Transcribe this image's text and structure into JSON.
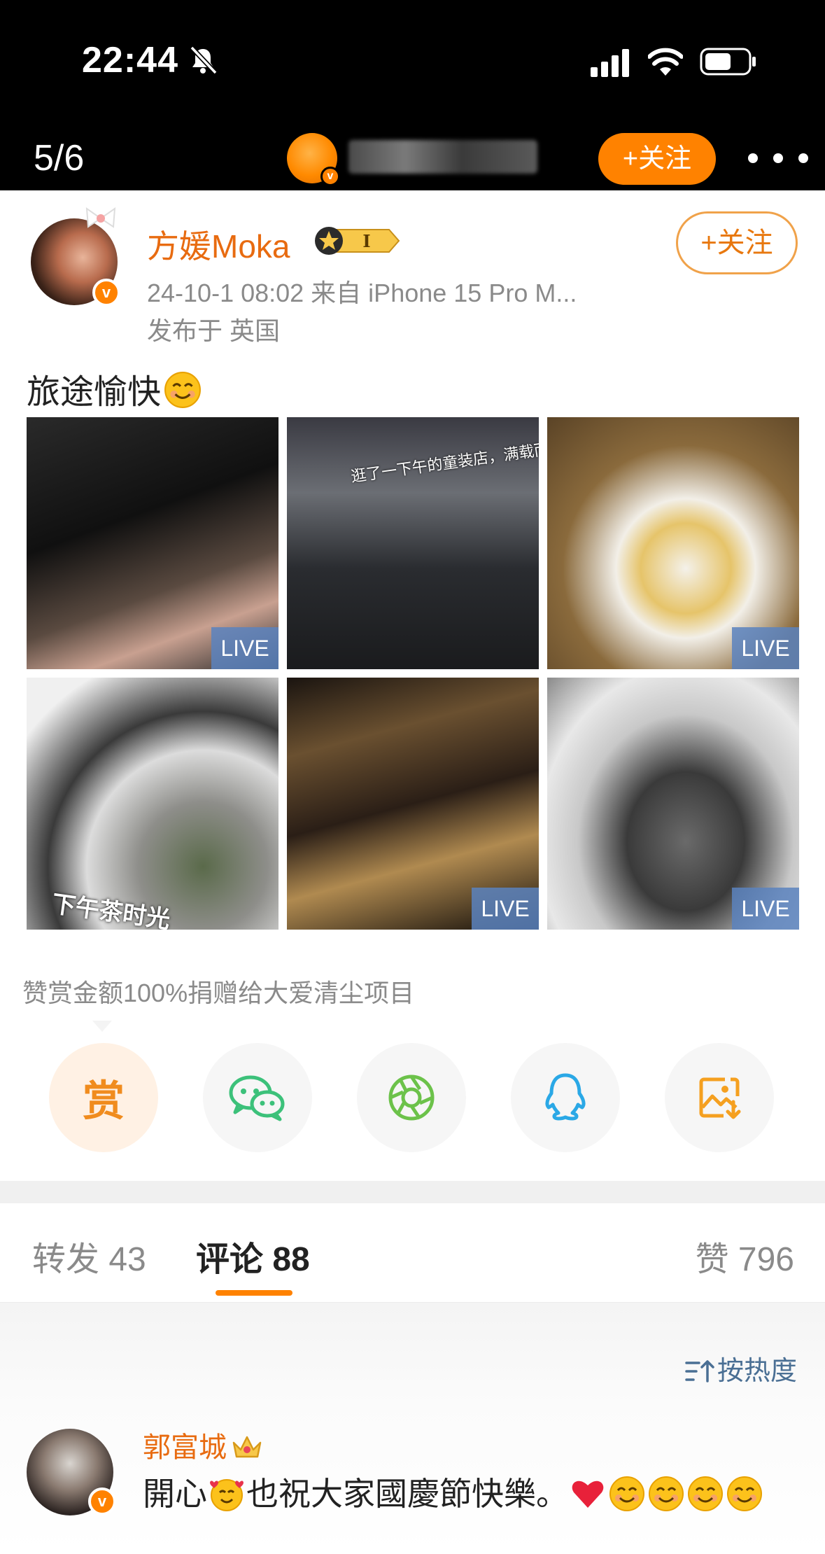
{
  "status_bar": {
    "time": "22:44"
  },
  "header": {
    "page_indicator": "5/6",
    "follow_label": "+关注"
  },
  "post": {
    "author": "方媛Moka",
    "vip_level": "I",
    "meta_line1": "24-10-1 08:02   来自 iPhone 15 Pro M...",
    "meta_line2": "发布于 英国",
    "follow_label": "+关注",
    "text": "旅途愉快",
    "photos": [
      {
        "live_label": "LIVE"
      },
      {
        "live_label": "",
        "caption": "逛了一下午的童装店，满载而归"
      },
      {
        "live_label": "LIVE"
      },
      {
        "live_label": "",
        "caption": "下午茶时光"
      },
      {
        "live_label": "LIVE"
      },
      {
        "live_label": "LIVE"
      }
    ],
    "reward_note": "赞赏金额100%捐赠给大爱清尘项目",
    "reward_button": "赏",
    "share_targets": [
      "wechat-icon",
      "moments-icon",
      "qq-icon",
      "save-image-icon"
    ]
  },
  "tabs": {
    "repost": "转发 43",
    "comments": "评论 88",
    "likes": "赞 796"
  },
  "comments": {
    "sort_label": "按热度",
    "items": [
      {
        "author": "郭富城",
        "text_a": "開心",
        "text_b": "也祝大家國慶節快樂。"
      }
    ]
  },
  "colors": {
    "brand_orange": "#ff8200",
    "name_orange": "#e86b10",
    "link_blue": "#4a6f94",
    "gray_text": "#8a8a8a"
  }
}
